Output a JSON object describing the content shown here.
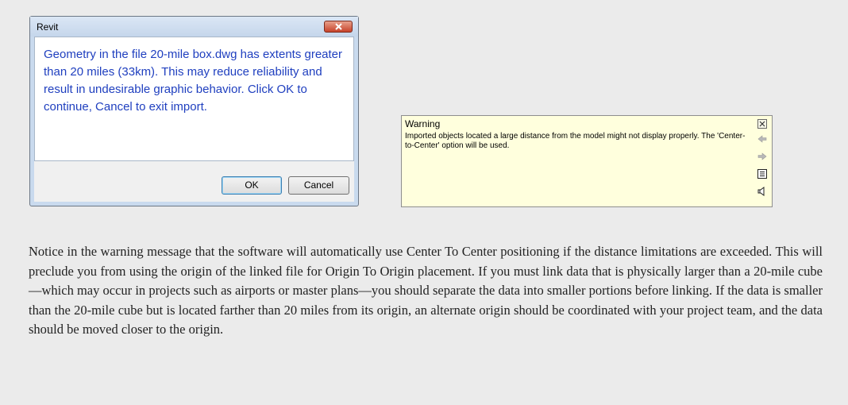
{
  "revit_dialog": {
    "title": "Revit",
    "message": "Geometry in the file 20-mile box.dwg has extents greater than 20 miles (33km). This may reduce reliability and result in undesirable graphic behavior. Click OK to continue, Cancel to exit import.",
    "ok_label": "OK",
    "cancel_label": "Cancel",
    "close_icon": "close-icon",
    "message_color": "#1f3fbf"
  },
  "warning_panel": {
    "title": "Warning",
    "message": "Imported objects located a large distance from the model might not display properly.  The 'Center-to-Center' option will be used.",
    "background_color": "#ffffdd",
    "icons": [
      "close-icon",
      "arrow-left-icon",
      "arrow-right-icon",
      "list-icon",
      "speaker-icon"
    ]
  },
  "body_text": "Notice in the warning message that the software will automatically use Center To Center positioning if the distance limitations are exceeded. This will preclude you from using the origin of the linked file for Origin To Origin placement. If you must link data that is physically larger than a 20-mile cube—which may occur in projects such as airports or master plans—you should separate the data into smaller portions before linking. If the data is smaller than the 20-mile cube but is located farther than 20 miles from its origin, an alternate origin should be coordinated with your project team, and the data should be moved closer to the origin."
}
